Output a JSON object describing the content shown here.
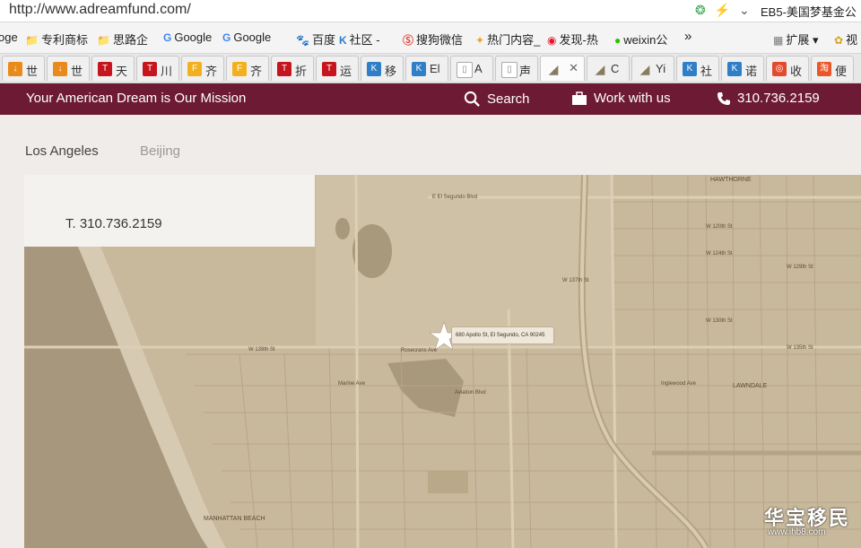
{
  "browser": {
    "url": "http://www.adreamfund.com/",
    "ext_title": "EB5-美国梦基金公",
    "bookmarks": [
      "oge",
      "专利商标",
      "思路企",
      "Google",
      "Google",
      "百度",
      "社区 -",
      "搜狗微信",
      "热门内容_",
      "发现-热",
      "weixin公",
      "»",
      "扩展",
      "视"
    ],
    "tabs": [
      {
        "label": "世",
        "fav": "#e88a1c",
        "glyph": "↓"
      },
      {
        "label": "世",
        "fav": "#e88a1c",
        "glyph": "↓"
      },
      {
        "label": "天",
        "fav": "#c4161c",
        "glyph": "T"
      },
      {
        "label": "川",
        "fav": "#c4161c",
        "glyph": "T"
      },
      {
        "label": "齐",
        "fav": "#f2b01e",
        "glyph": "F"
      },
      {
        "label": "齐",
        "fav": "#f2b01e",
        "glyph": "F"
      },
      {
        "label": "折",
        "fav": "#c4161c",
        "glyph": "T"
      },
      {
        "label": "运",
        "fav": "#c4161c",
        "glyph": "T"
      },
      {
        "label": "移",
        "fav": "#2f7fc8",
        "glyph": "K"
      },
      {
        "label": "El",
        "fav": "#2f7fc8",
        "glyph": "K"
      },
      {
        "label": "A",
        "fav": "#ffffff",
        "glyph": "▯"
      },
      {
        "label": "声",
        "fav": "#ffffff",
        "glyph": "▯"
      },
      {
        "label": "",
        "fav": "#8a7a5e",
        "glyph": "◢",
        "active": true
      },
      {
        "label": "C",
        "fav": "#8a7a5e",
        "glyph": "◢"
      },
      {
        "label": "Yi",
        "fav": "#8a7a5e",
        "glyph": "◢"
      },
      {
        "label": "社",
        "fav": "#2f7fc8",
        "glyph": "K"
      },
      {
        "label": "诺",
        "fav": "#2f7fc8",
        "glyph": "K"
      },
      {
        "label": "收",
        "fav": "#e34b2d",
        "glyph": "◎"
      },
      {
        "label": "便",
        "fav": "#e8572a",
        "glyph": "淘"
      }
    ]
  },
  "site": {
    "tagline": "Your American Dream is Our Mission",
    "search_label": "Search",
    "work_label": "Work with us",
    "phone_label": "310.736.2159",
    "accent": "#6d1b35"
  },
  "cities": {
    "la": "Los Angeles",
    "bj": "Beijing"
  },
  "card": {
    "phone": "T. 310.736.2159"
  },
  "map": {
    "address": "680 Apollo St, El Segundo, CA  90245",
    "labels": [
      "E El Segundo Blvd",
      "HAWTHORNE",
      "W 120th St",
      "W 124th St",
      "W 129th St",
      "W 130th St",
      "W 135th St",
      "W 137th St",
      "W 139th St",
      "Rosecrans Ave",
      "LAWNDALE",
      "MANHATTAN BEACH",
      "Aviation Blvd",
      "Inglewood Ave",
      "Marine Ave"
    ]
  },
  "watermark": {
    "title": "华宝移民",
    "sub": "www.ihb8.com"
  }
}
